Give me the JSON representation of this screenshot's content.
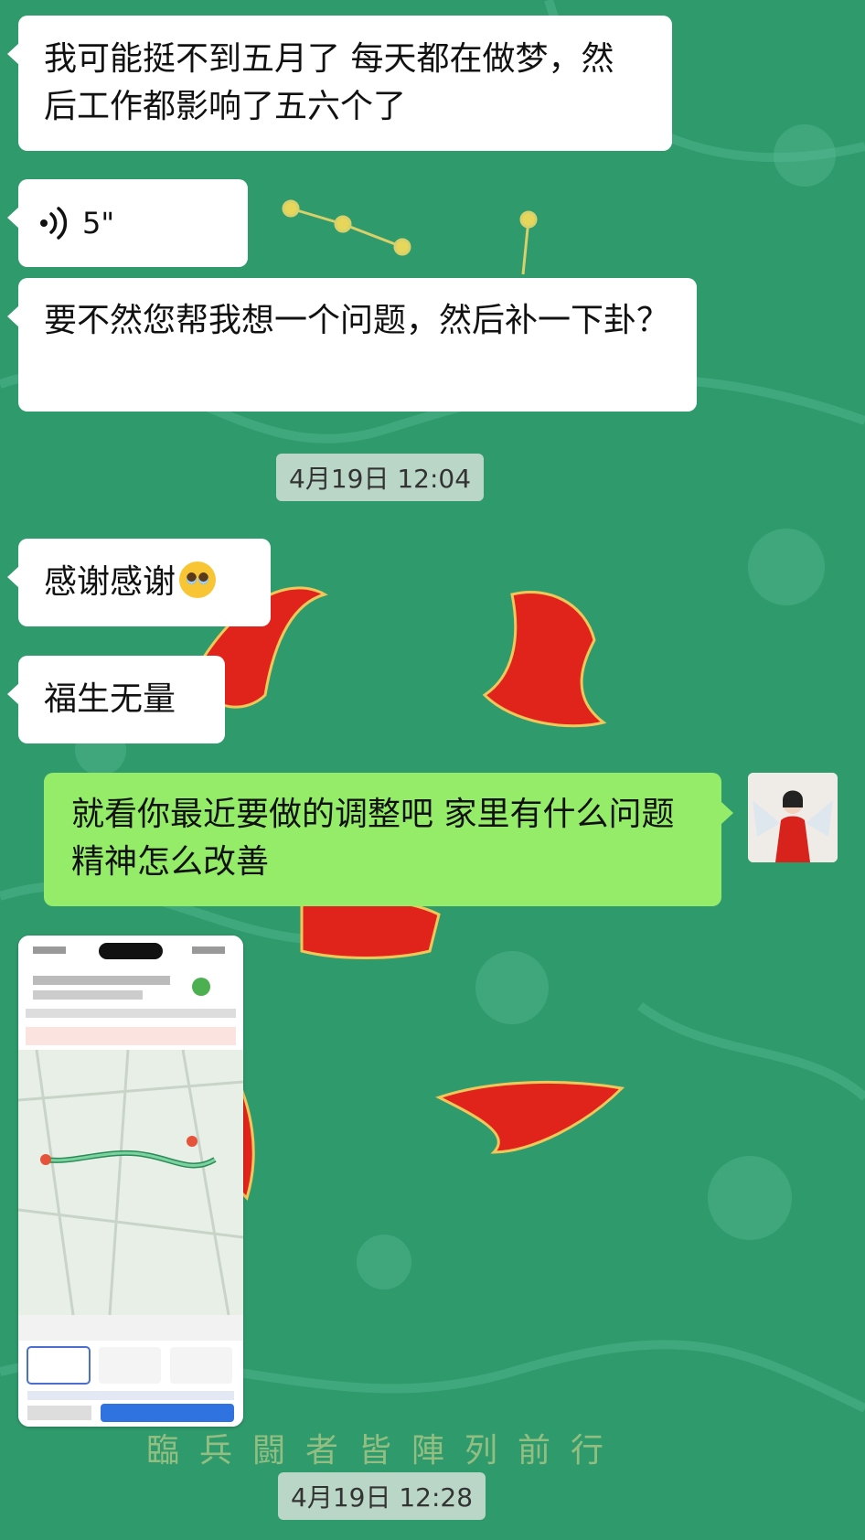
{
  "messages": [
    {
      "side": "in",
      "text": "我可能挺不到五月了 每天都在做梦，然后工作都影响了五六个了"
    },
    {
      "side": "in",
      "type": "voice",
      "duration": "5\""
    },
    {
      "side": "in",
      "text": "要不然您帮我想一个问题，然后补一下卦？"
    },
    {
      "type": "time",
      "text": "4月19日 12:04"
    },
    {
      "side": "in",
      "text": "感谢感谢",
      "emoji": "pleading-face-icon"
    },
    {
      "side": "in",
      "text": "福生无量"
    },
    {
      "side": "out",
      "text": "就看你最近要做的调整吧 家里有什么问题 精神怎么改善"
    },
    {
      "side": "in",
      "type": "image",
      "description_icon": "map-screenshot"
    },
    {
      "type": "time",
      "text": "4月19日 12:28"
    }
  ],
  "background_caption": "臨兵闘者皆陣列前行",
  "colors": {
    "background": "#2f9a6c",
    "bubble_in": "#ffffff",
    "bubble_out": "#95ec69",
    "emblem": "#e0241c"
  }
}
